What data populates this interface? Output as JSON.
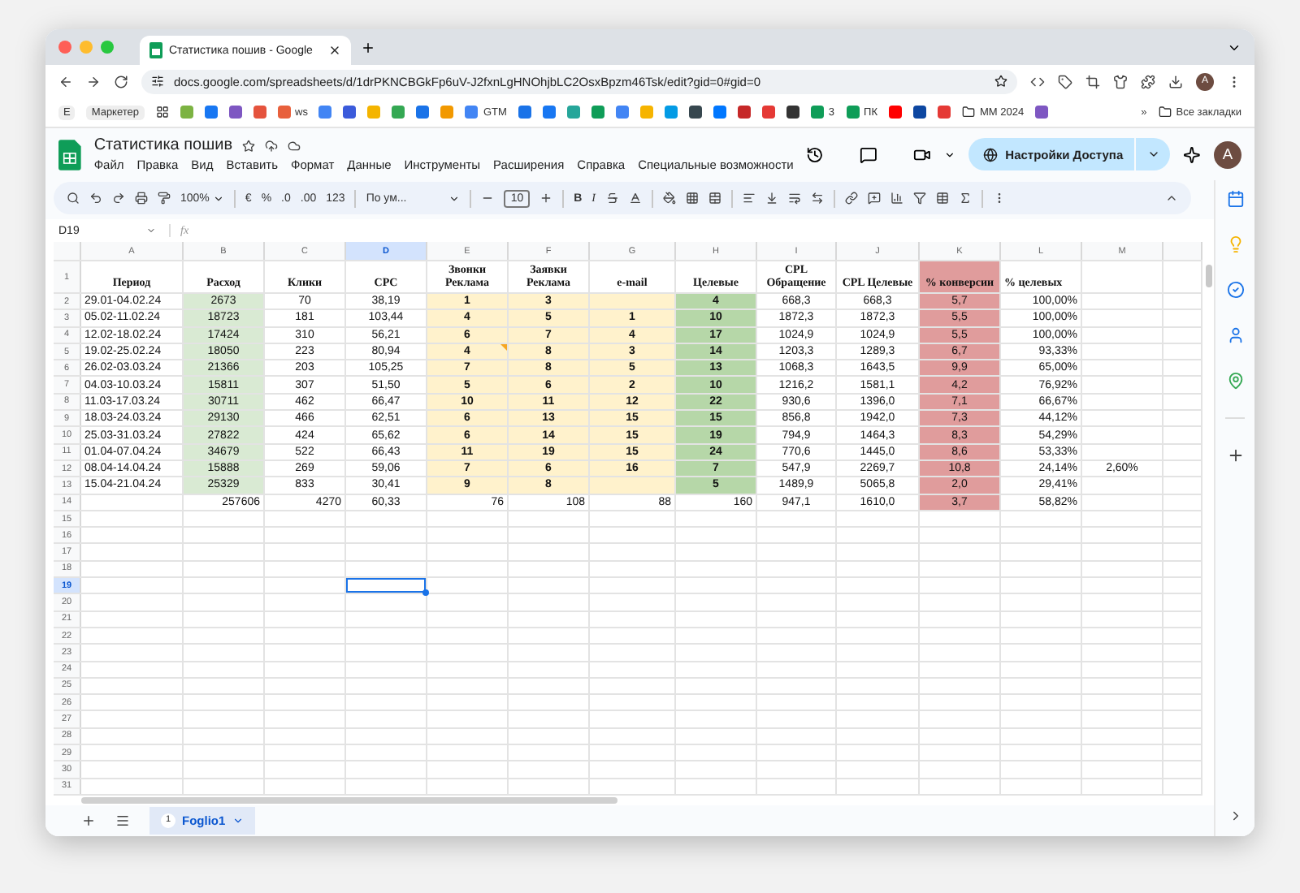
{
  "browser": {
    "tab_title": "Статистика пошив - Google",
    "url": "docs.google.com/spreadsheets/d/1drPKNCBGkFp6uV-J2fxnLgHNOhjbLC2OsxBpzm46Tsk/edit?gid=0#gid=0",
    "avatar": "A",
    "bookmarks": [
      {
        "kind": "chip",
        "label": "E"
      },
      {
        "kind": "chip",
        "label": "Маркетер"
      },
      {
        "kind": "apps"
      },
      {
        "kind": "site",
        "color": "#7cb342"
      },
      {
        "kind": "site",
        "color": "#1877f2"
      },
      {
        "kind": "site",
        "color": "#7e57c2"
      },
      {
        "kind": "site",
        "color": "#e5533d"
      },
      {
        "kind": "site",
        "color": "#e8603c",
        "label": "ws"
      },
      {
        "kind": "site",
        "color": "#4285f4"
      },
      {
        "kind": "site",
        "color": "#3b5bdb"
      },
      {
        "kind": "site",
        "color": "#f4b400"
      },
      {
        "kind": "site",
        "color": "#34a853"
      },
      {
        "kind": "site",
        "color": "#1a73e8"
      },
      {
        "kind": "site",
        "color": "#f29900"
      },
      {
        "kind": "site",
        "color": "#4285f4",
        "label": "GTM"
      },
      {
        "kind": "site",
        "color": "#1a73e8"
      },
      {
        "kind": "site",
        "color": "#1877f2"
      },
      {
        "kind": "site",
        "color": "#26a69a"
      },
      {
        "kind": "site",
        "color": "#0f9d58"
      },
      {
        "kind": "site",
        "color": "#4285f4"
      },
      {
        "kind": "site",
        "color": "#f6b400"
      },
      {
        "kind": "site",
        "color": "#039be5"
      },
      {
        "kind": "site",
        "color": "#37474f"
      },
      {
        "kind": "site",
        "color": "#0077ff"
      },
      {
        "kind": "site",
        "color": "#c62828"
      },
      {
        "kind": "site",
        "color": "#e53935"
      },
      {
        "kind": "site",
        "color": "#333333"
      },
      {
        "kind": "site",
        "color": "#0f9d58",
        "label": "3"
      },
      {
        "kind": "site",
        "color": "#0f9d58",
        "label": "ПК"
      },
      {
        "kind": "site",
        "color": "#ff0000"
      },
      {
        "kind": "site",
        "color": "#0d47a1"
      },
      {
        "kind": "site",
        "color": "#e53935"
      },
      {
        "kind": "folder",
        "label": "ММ 2024"
      },
      {
        "kind": "site",
        "color": "#7e57c2"
      }
    ],
    "more": "»",
    "all_bookmarks": "Все закладки"
  },
  "document": {
    "title": "Статистика пошив",
    "menu": [
      "Файл",
      "Правка",
      "Вид",
      "Вставить",
      "Формат",
      "Данные",
      "Инструменты",
      "Расширения",
      "Справка",
      "Специальные возможности"
    ],
    "share_button": "Настройки Доступа",
    "avatar": "A"
  },
  "toolbar": {
    "zoom": "100%",
    "currency": "€",
    "percent": "%",
    "decrease_decimals": ".0",
    "increase_decimals": ".00",
    "number_format": "123",
    "font": "По ум...",
    "font_size": "10",
    "bold": "B",
    "italic": "I"
  },
  "formula_bar": {
    "cell": "D19",
    "fx": "fx"
  },
  "sheet": {
    "columns": [
      {
        "label": "A",
        "selected": false
      },
      {
        "label": "B",
        "selected": false
      },
      {
        "label": "C",
        "selected": false
      },
      {
        "label": "D",
        "selected": true
      },
      {
        "label": "E",
        "selected": false
      },
      {
        "label": "F",
        "selected": false
      },
      {
        "label": "G",
        "selected": false
      },
      {
        "label": "H",
        "selected": false
      },
      {
        "label": "I",
        "selected": false
      },
      {
        "label": "J",
        "selected": false
      },
      {
        "label": "K",
        "selected": false
      },
      {
        "label": "L",
        "selected": false
      },
      {
        "label": "M",
        "selected": false
      }
    ],
    "rows": [
      {
        "number": "1",
        "kind": "header",
        "selected": false,
        "cells": [
          "Период",
          "Расход",
          "Клики",
          "CPC",
          "Звонки Реклама",
          "Заявки Реклама",
          "e-mail",
          "Целевые",
          "CPL Обращение",
          "CPL Целевые",
          {
            "text": "% конверсии",
            "color": "#e09c9c"
          },
          "% целевых",
          null
        ]
      },
      {
        "number": "2",
        "kind": "data",
        "selected": false,
        "cells": [
          "29.01-04.02.24",
          {
            "text": "2673",
            "color": "#d9ead3"
          },
          "70",
          "38,19",
          {
            "text": "1",
            "color": "#fff2cc",
            "bold": true
          },
          {
            "text": "3",
            "color": "#fff2cc",
            "bold": true
          },
          {
            "color": "#fff2cc"
          },
          {
            "text": "4",
            "color": "#b6d7a8",
            "bold": true
          },
          "668,3",
          "668,3",
          {
            "text": "5,7",
            "color": "#e09c9c"
          },
          "100,00%",
          null
        ]
      },
      {
        "number": "3",
        "kind": "data",
        "selected": false,
        "cells": [
          "05.02-11.02.24",
          {
            "text": "18723",
            "color": "#d9ead3"
          },
          "181",
          "103,44",
          {
            "text": "4",
            "color": "#fff2cc",
            "bold": true
          },
          {
            "text": "5",
            "color": "#fff2cc",
            "bold": true
          },
          {
            "text": "1",
            "color": "#fff2cc",
            "bold": true
          },
          {
            "text": "10",
            "color": "#b6d7a8",
            "bold": true
          },
          "1872,3",
          "1872,3",
          {
            "text": "5,5",
            "color": "#e09c9c"
          },
          "100,00%",
          null
        ]
      },
      {
        "number": "4",
        "kind": "data",
        "selected": false,
        "cells": [
          "12.02-18.02.24",
          {
            "text": "17424",
            "color": "#d9ead3"
          },
          "310",
          "56,21",
          {
            "text": "6",
            "color": "#fff2cc",
            "bold": true
          },
          {
            "text": "7",
            "color": "#fff2cc",
            "bold": true
          },
          {
            "text": "4",
            "color": "#fff2cc",
            "bold": true
          },
          {
            "text": "17",
            "color": "#b6d7a8",
            "bold": true
          },
          "1024,9",
          "1024,9",
          {
            "text": "5,5",
            "color": "#e09c9c"
          },
          "100,00%",
          null
        ]
      },
      {
        "number": "5",
        "kind": "data",
        "selected": false,
        "cells": [
          "19.02-25.02.24",
          {
            "text": "18050",
            "color": "#d9ead3"
          },
          "223",
          "80,94",
          {
            "text": "4",
            "color": "#fff2cc",
            "bold": true,
            "comment": true
          },
          {
            "text": "8",
            "color": "#fff2cc",
            "bold": true
          },
          {
            "text": "3",
            "color": "#fff2cc",
            "bold": true
          },
          {
            "text": "14",
            "color": "#b6d7a8",
            "bold": true
          },
          "1203,3",
          "1289,3",
          {
            "text": "6,7",
            "color": "#e09c9c"
          },
          "93,33%",
          null
        ]
      },
      {
        "number": "6",
        "kind": "data",
        "selected": false,
        "cells": [
          "26.02-03.03.24",
          {
            "text": "21366",
            "color": "#d9ead3"
          },
          "203",
          "105,25",
          {
            "text": "7",
            "color": "#fff2cc",
            "bold": true
          },
          {
            "text": "8",
            "color": "#fff2cc",
            "bold": true
          },
          {
            "text": "5",
            "color": "#fff2cc",
            "bold": true
          },
          {
            "text": "13",
            "color": "#b6d7a8",
            "bold": true
          },
          "1068,3",
          "1643,5",
          {
            "text": "9,9",
            "color": "#e09c9c"
          },
          "65,00%",
          null
        ]
      },
      {
        "number": "7",
        "kind": "data",
        "selected": false,
        "cells": [
          "04.03-10.03.24",
          {
            "text": "15811",
            "color": "#d9ead3"
          },
          "307",
          "51,50",
          {
            "text": "5",
            "color": "#fff2cc",
            "bold": true
          },
          {
            "text": "6",
            "color": "#fff2cc",
            "bold": true
          },
          {
            "text": "2",
            "color": "#fff2cc",
            "bold": true
          },
          {
            "text": "10",
            "color": "#b6d7a8",
            "bold": true
          },
          "1216,2",
          "1581,1",
          {
            "text": "4,2",
            "color": "#e09c9c"
          },
          "76,92%",
          null
        ]
      },
      {
        "number": "8",
        "kind": "data",
        "selected": false,
        "cells": [
          "11.03-17.03.24",
          {
            "text": "30711",
            "color": "#d9ead3"
          },
          "462",
          "66,47",
          {
            "text": "10",
            "color": "#fff2cc",
            "bold": true
          },
          {
            "text": "11",
            "color": "#fff2cc",
            "bold": true
          },
          {
            "text": "12",
            "color": "#fff2cc",
            "bold": true
          },
          {
            "text": "22",
            "color": "#b6d7a8",
            "bold": true
          },
          "930,6",
          "1396,0",
          {
            "text": "7,1",
            "color": "#e09c9c"
          },
          "66,67%",
          null
        ]
      },
      {
        "number": "9",
        "kind": "data",
        "selected": false,
        "cells": [
          "18.03-24.03.24",
          {
            "text": "29130",
            "color": "#d9ead3"
          },
          "466",
          "62,51",
          {
            "text": "6",
            "color": "#fff2cc",
            "bold": true
          },
          {
            "text": "13",
            "color": "#fff2cc",
            "bold": true
          },
          {
            "text": "15",
            "color": "#fff2cc",
            "bold": true
          },
          {
            "text": "15",
            "color": "#b6d7a8",
            "bold": true
          },
          "856,8",
          "1942,0",
          {
            "text": "7,3",
            "color": "#e09c9c"
          },
          "44,12%",
          null
        ]
      },
      {
        "number": "10",
        "kind": "data",
        "selected": false,
        "cells": [
          "25.03-31.03.24",
          {
            "text": "27822",
            "color": "#d9ead3"
          },
          "424",
          "65,62",
          {
            "text": "6",
            "color": "#fff2cc",
            "bold": true
          },
          {
            "text": "14",
            "color": "#fff2cc",
            "bold": true
          },
          {
            "text": "15",
            "color": "#fff2cc",
            "bold": true
          },
          {
            "text": "19",
            "color": "#b6d7a8",
            "bold": true
          },
          "794,9",
          "1464,3",
          {
            "text": "8,3",
            "color": "#e09c9c"
          },
          "54,29%",
          null
        ]
      },
      {
        "number": "11",
        "kind": "data",
        "selected": false,
        "cells": [
          "01.04-07.04.24",
          {
            "text": "34679",
            "color": "#d9ead3"
          },
          "522",
          "66,43",
          {
            "text": "11",
            "color": "#fff2cc",
            "bold": true
          },
          {
            "text": "19",
            "color": "#fff2cc",
            "bold": true
          },
          {
            "text": "15",
            "color": "#fff2cc",
            "bold": true
          },
          {
            "text": "24",
            "color": "#b6d7a8",
            "bold": true
          },
          "770,6",
          "1445,0",
          {
            "text": "8,6",
            "color": "#e09c9c"
          },
          "53,33%",
          null
        ]
      },
      {
        "number": "12",
        "kind": "data",
        "selected": false,
        "cells": [
          "08.04-14.04.24",
          {
            "text": "15888",
            "color": "#d9ead3"
          },
          "269",
          "59,06",
          {
            "text": "7",
            "color": "#fff2cc",
            "bold": true
          },
          {
            "text": "6",
            "color": "#fff2cc",
            "bold": true
          },
          {
            "text": "16",
            "color": "#fff2cc",
            "bold": true
          },
          {
            "text": "7",
            "color": "#b6d7a8",
            "bold": true
          },
          "547,9",
          "2269,7",
          {
            "text": "10,8",
            "color": "#e09c9c"
          },
          "24,14%",
          "2,60%"
        ]
      },
      {
        "number": "13",
        "kind": "data",
        "selected": false,
        "cells": [
          "15.04-21.04.24",
          {
            "text": "25329",
            "color": "#d9ead3"
          },
          "833",
          "30,41",
          {
            "text": "9",
            "color": "#fff2cc",
            "bold": true
          },
          {
            "text": "8",
            "color": "#fff2cc",
            "bold": true
          },
          {
            "color": "#fff2cc"
          },
          {
            "text": "5",
            "color": "#b6d7a8",
            "bold": true
          },
          "1489,9",
          "5065,8",
          {
            "text": "2,0",
            "color": "#e09c9c"
          },
          "29,41%",
          null
        ]
      },
      {
        "number": "14",
        "kind": "total",
        "selected": false,
        "cells": [
          null,
          "257606",
          "4270",
          "60,33",
          "76",
          "108",
          "88",
          "160",
          "947,1",
          "1610,0",
          {
            "text": "3,7",
            "color": "#e09c9c"
          },
          "58,82%",
          null
        ]
      },
      {
        "number": "15",
        "kind": "blank",
        "selected": false
      },
      {
        "number": "16",
        "kind": "blank",
        "selected": false
      },
      {
        "number": "17",
        "kind": "blank",
        "selected": false
      },
      {
        "number": "18",
        "kind": "blank",
        "selected": false
      },
      {
        "number": "19",
        "kind": "blank",
        "selected": true
      },
      {
        "number": "20",
        "kind": "blank",
        "selected": false
      },
      {
        "number": "21",
        "kind": "blank",
        "selected": false
      },
      {
        "number": "22",
        "kind": "blank",
        "selected": false
      },
      {
        "number": "23",
        "kind": "blank",
        "selected": false
      },
      {
        "number": "24",
        "kind": "blank",
        "selected": false
      },
      {
        "number": "25",
        "kind": "blank",
        "selected": false
      },
      {
        "number": "26",
        "kind": "blank",
        "selected": false
      },
      {
        "number": "27",
        "kind": "blank",
        "selected": false
      },
      {
        "number": "28",
        "kind": "blank",
        "selected": false
      },
      {
        "number": "29",
        "kind": "blank",
        "selected": false
      },
      {
        "number": "30",
        "kind": "blank",
        "selected": false
      },
      {
        "number": "31",
        "kind": "blank",
        "selected": false
      }
    ]
  },
  "sheet_tabs": [
    {
      "index": "1",
      "label": "Foglio1",
      "selected": true
    }
  ]
}
